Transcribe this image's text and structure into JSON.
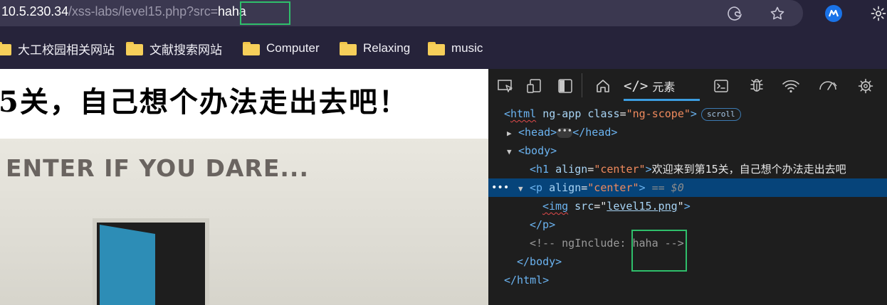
{
  "address_bar": {
    "host": "10.5.230.34",
    "path": "/xss-labs/level15.php?src=",
    "param_value": "haha",
    "icons": [
      "edge-icon",
      "favorite-star-icon",
      "profile-icon",
      "settings-gear-icon"
    ]
  },
  "bookmarks": [
    {
      "label": "大工校园相关网站",
      "icon": "folder-icon"
    },
    {
      "label": "文献搜索网站",
      "icon": "folder-icon"
    },
    {
      "label": "Computer",
      "icon": "folder-icon"
    },
    {
      "label": "Relaxing",
      "icon": "folder-icon"
    },
    {
      "label": "music",
      "icon": "folder-icon"
    }
  ],
  "page": {
    "heading": "5关，自己想个办法走出去吧！",
    "image_caption": "ENTER IF YOU DARE..."
  },
  "devtools": {
    "toolbar_icons": [
      "inspect-icon",
      "device-emulation-icon",
      "dock-icon",
      "home-icon",
      "elements-icon",
      "console-icon",
      "debug-bug-icon",
      "network-wifi-icon",
      "performance-icon",
      "settings-gear-icon"
    ],
    "active_tab": "元素",
    "dom": {
      "html_open": {
        "tag": "html",
        "attr1": "ng-app",
        "attr2": "class",
        "attr2_val": "\"ng-scope\"",
        "badge": "scroll"
      },
      "head": {
        "open": "<head>",
        "badge": "•••",
        "close": "</head>"
      },
      "body_open": "<body>",
      "h1": {
        "tag_open": "<h1",
        "attr": "align",
        "val": "\"center\"",
        "text": "欢迎来到第15关，自己想个办法走出去吧"
      },
      "p_open": {
        "tag_open": "<p",
        "attr": "align",
        "val": "\"center\"",
        "marker": "== $0"
      },
      "img": {
        "tag_open": "<img",
        "attr": "src",
        "val": "level15.png"
      },
      "p_close": "</p>",
      "comment": "<!-- ngInclude: haha -->",
      "body_close": "</body>",
      "html_close": "</html>"
    }
  }
}
